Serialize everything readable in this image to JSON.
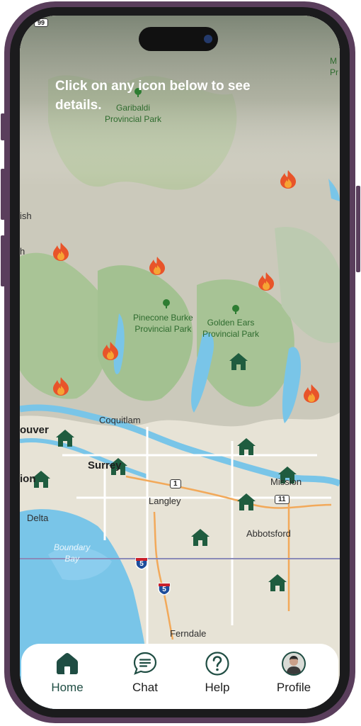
{
  "instruction": "Click on any icon below to see details.",
  "map": {
    "places": {
      "garibaldi": [
        "Garibaldi",
        "Provincial Park"
      ],
      "pinecone": [
        "Pinecone Burke",
        "Provincial Park"
      ],
      "golden": [
        "Golden Ears",
        "Provincial Park"
      ],
      "coquitlam": "Coquitlam",
      "vancouver": "ouver",
      "surrey": "Surrey",
      "richmond": "ion",
      "langley": "Langley",
      "mission": "Mission",
      "delta": "Delta",
      "abbotsford": "Abbotsford",
      "ferndale": "Ferndale",
      "boundary_bay": [
        "Boundary",
        "Bay"
      ],
      "edge_left_1": "ish",
      "edge_left_2": "h",
      "edge_right": [
        "M",
        "Pr"
      ]
    },
    "highways": {
      "h1": "1",
      "h11": "11",
      "i5a": "5",
      "i5b": "5",
      "h99": "99"
    },
    "fire_color": "#e8542a",
    "house_color": "#1f5c3f"
  },
  "nav": {
    "home": "Home",
    "chat": "Chat",
    "help": "Help",
    "profile": "Profile",
    "active_color": "#1f4d43"
  }
}
